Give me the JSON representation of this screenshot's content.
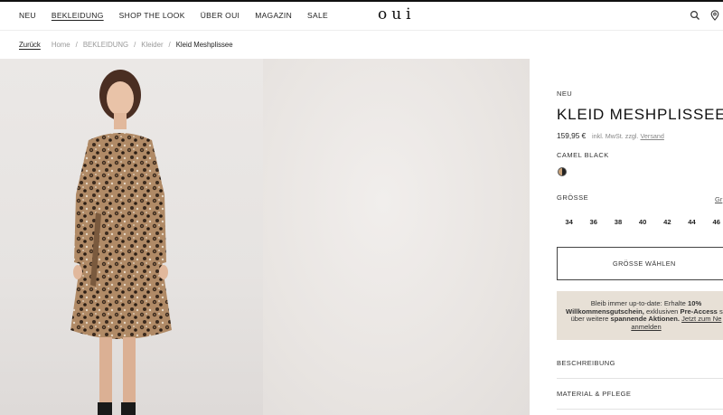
{
  "header": {
    "nav": [
      {
        "label": "NEU",
        "active": false
      },
      {
        "label": "BEKLEIDUNG",
        "active": true
      },
      {
        "label": "SHOP THE LOOK",
        "active": false
      },
      {
        "label": "ÜBER OUI",
        "active": false
      },
      {
        "label": "MAGAZIN",
        "active": false
      },
      {
        "label": "SALE",
        "active": false
      }
    ],
    "logo": "oui",
    "icons": [
      "search-icon",
      "location-pin-icon"
    ]
  },
  "breadcrumb": {
    "back": "Zurück",
    "items": [
      "Home",
      "BEKLEIDUNG",
      "Kleider"
    ],
    "current": "Kleid Meshplissee"
  },
  "product": {
    "badge": "NEU",
    "title": "KLEID MESHPLISSEE",
    "price": "159,95 €",
    "tax_prefix": "inkl. MwSt. zzgl.",
    "shipping_link": "Versand",
    "color_label": "CAMEL BLACK",
    "size_label": "GRÖSSE",
    "size_guide": "Gr",
    "sizes": [
      "34",
      "36",
      "38",
      "40",
      "42",
      "44",
      "46"
    ],
    "choose_size": "GRÖSSE WÄHLEN",
    "promo": {
      "t1": "Bleib immer up-to-date: Erhalte ",
      "b1": "10% Willkommensgutschein,",
      "t2": " exklusiven ",
      "b2": "Pre-Access",
      "t3": " so",
      "t4": "über weitere ",
      "b3": "spannende Aktionen.",
      "link": "Jetzt zum Ne",
      "link2": "anmelden"
    },
    "accordion": [
      "BESCHREIBUNG",
      "MATERIAL & PFLEGE"
    ]
  },
  "colors": {
    "promo_bg": "#e7e0d6",
    "text": "#222222",
    "image_bg": "#e9e6e4"
  }
}
